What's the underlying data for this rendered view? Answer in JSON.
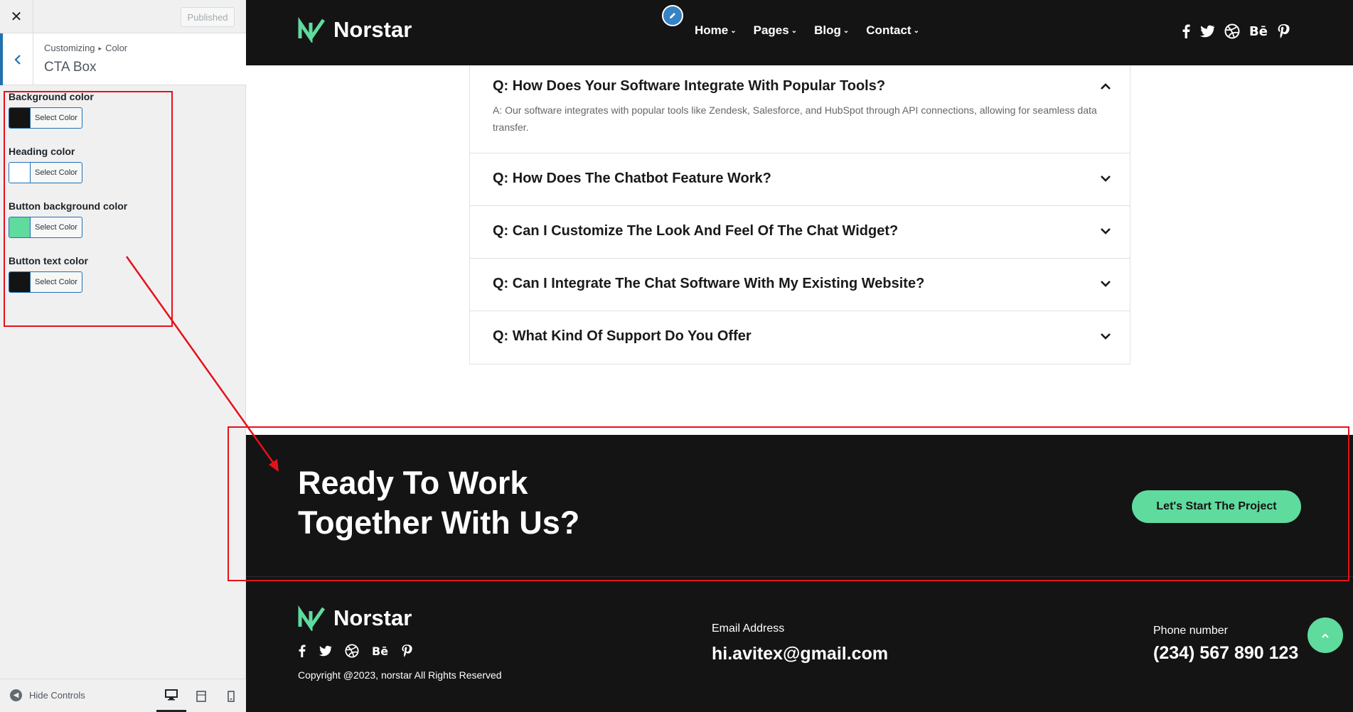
{
  "customizer": {
    "close_icon": "✕",
    "publish_label": "Published",
    "breadcrumb_parent": "Customizing",
    "breadcrumb_sep": "▸",
    "breadcrumb_current": "Color",
    "section_title": "CTA Box",
    "controls": [
      {
        "label": "Background color",
        "button": "Select Color",
        "color": "#141414"
      },
      {
        "label": "Heading color",
        "button": "Select Color",
        "color": "#ffffff"
      },
      {
        "label": "Button background color",
        "button": "Select Color",
        "color": "#5fdb9e"
      },
      {
        "label": "Button text color",
        "button": "Select Color",
        "color": "#141414"
      }
    ],
    "hide_controls_label": "Hide Controls"
  },
  "site": {
    "brand": "Norstar",
    "accent_color": "#5fdb9e",
    "dark_color": "#141414",
    "nav": [
      {
        "label": "Home",
        "caret": "⌄"
      },
      {
        "label": "Pages",
        "caret": "⌄"
      },
      {
        "label": "Blog",
        "caret": "⌄"
      },
      {
        "label": "Contact",
        "caret": "⌄"
      }
    ],
    "social_icons": [
      "facebook-icon",
      "twitter-icon",
      "dribbble-icon",
      "behance-icon",
      "pinterest-icon"
    ],
    "behance_text": "Bē"
  },
  "faq": [
    {
      "q": "Q: How Does Your Software Integrate With Popular Tools?",
      "a": "A: Our software integrates with popular tools like Zendesk, Salesforce, and HubSpot through API connections, allowing for seamless data transfer.",
      "open": true
    },
    {
      "q": "Q: How Does The Chatbot Feature Work?",
      "open": false
    },
    {
      "q": "Q: Can I Customize The Look And Feel Of The Chat Widget?",
      "open": false
    },
    {
      "q": "Q: Can I Integrate The Chat Software With My Existing Website?",
      "open": false
    },
    {
      "q": "Q: What Kind Of Support Do You Offer",
      "open": false
    }
  ],
  "cta": {
    "heading_line1": "Ready To Work",
    "heading_line2": "Together With Us?",
    "button": "Let's Start The Project"
  },
  "footer": {
    "email_label": "Email Address",
    "email": "hi.avitex@gmail.com",
    "phone_label": "Phone number",
    "phone": "(234) 567 890 123",
    "copyright": "Copyright @2023, norstar All Rights Reserved"
  }
}
